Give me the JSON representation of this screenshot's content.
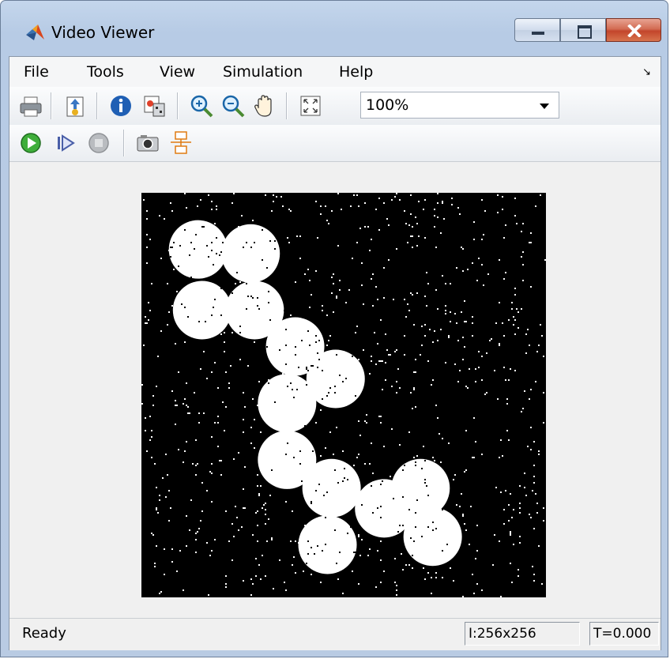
{
  "window": {
    "title": "Video Viewer"
  },
  "menu": [
    "File",
    "Tools",
    "View",
    "Simulation",
    "Help"
  ],
  "toolbar": {
    "icons1": [
      "print-icon",
      "open-file-icon",
      "info-icon",
      "colormap-icon",
      "zoom-in-icon",
      "zoom-out-icon",
      "pan-hand-icon",
      "fit-to-view-icon"
    ],
    "zoom_value": "100%",
    "icons2": [
      "play-icon",
      "step-forward-icon",
      "stop-icon",
      "snapshot-camera-icon",
      "highlight-block-icon"
    ]
  },
  "video": {
    "background": "#000000",
    "foreground": "#ffffff",
    "blobs_fraction": [
      [
        0.14,
        0.14
      ],
      [
        0.27,
        0.15
      ],
      [
        0.15,
        0.29
      ],
      [
        0.28,
        0.29
      ],
      [
        0.38,
        0.38
      ],
      [
        0.48,
        0.46
      ],
      [
        0.36,
        0.52
      ],
      [
        0.36,
        0.66
      ],
      [
        0.47,
        0.73
      ],
      [
        0.6,
        0.78
      ],
      [
        0.69,
        0.73
      ],
      [
        0.46,
        0.87
      ],
      [
        0.72,
        0.85
      ]
    ]
  },
  "status": {
    "text": "Ready",
    "size": "I:256x256",
    "time": "T=0.000"
  }
}
